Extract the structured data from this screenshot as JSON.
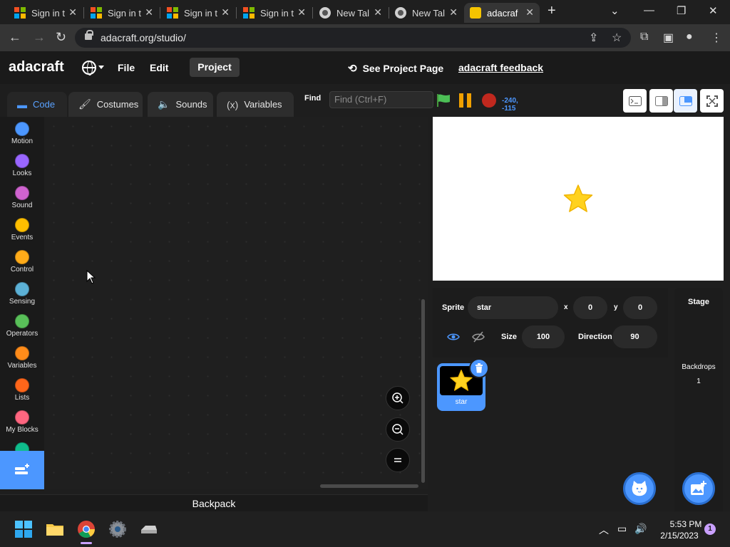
{
  "browser": {
    "tabs": [
      {
        "title": "Sign in t",
        "icon": "microsoft-icon"
      },
      {
        "title": "Sign in t",
        "icon": "microsoft-icon"
      },
      {
        "title": "Sign in t",
        "icon": "microsoft-icon"
      },
      {
        "title": "Sign in t",
        "icon": "microsoft-icon"
      },
      {
        "title": "New Tal",
        "icon": "chrome-icon"
      },
      {
        "title": "New Tal",
        "icon": "chrome-icon"
      },
      {
        "title": "adacraf",
        "icon": "adacraft-icon"
      }
    ],
    "url": "adacraft.org/studio/"
  },
  "app": {
    "logo": "adacraft",
    "menu": {
      "file": "File",
      "edit": "Edit",
      "project": "Project"
    },
    "see_project": "See Project Page",
    "feedback": "adacraft feedback"
  },
  "editor": {
    "tabs": {
      "code": "Code",
      "costumes": "Costumes",
      "sounds": "Sounds",
      "variables": "Variables"
    },
    "find_label": "Find",
    "find_placeholder": "Find (Ctrl+F)",
    "coords": "-240, -115",
    "backpack": "Backpack"
  },
  "categories": [
    {
      "label": "Motion",
      "color": "#4C97FF"
    },
    {
      "label": "Looks",
      "color": "#9966FF"
    },
    {
      "label": "Sound",
      "color": "#CF63CF"
    },
    {
      "label": "Events",
      "color": "#FFBF00"
    },
    {
      "label": "Control",
      "color": "#FFAB19"
    },
    {
      "label": "Sensing",
      "color": "#5CB1D6"
    },
    {
      "label": "Operators",
      "color": "#59C059"
    },
    {
      "label": "Variables",
      "color": "#FF8C1A"
    },
    {
      "label": "Lists",
      "color": "#FF661A"
    },
    {
      "label": "My Blocks",
      "color": "#FF6680"
    }
  ],
  "sprite": {
    "label": "Sprite",
    "name": "star",
    "x_label": "x",
    "x": "0",
    "y_label": "y",
    "y": "0",
    "size_label": "Size",
    "size": "100",
    "direction_label": "Direction",
    "direction": "90",
    "thumb_name": "star"
  },
  "stage_panel": {
    "title": "Stage",
    "backdrops_label": "Backdrops",
    "backdrops_count": "1"
  },
  "taskbar": {
    "time": "5:53 PM",
    "date": "2/15/2023",
    "notifications": "1"
  }
}
